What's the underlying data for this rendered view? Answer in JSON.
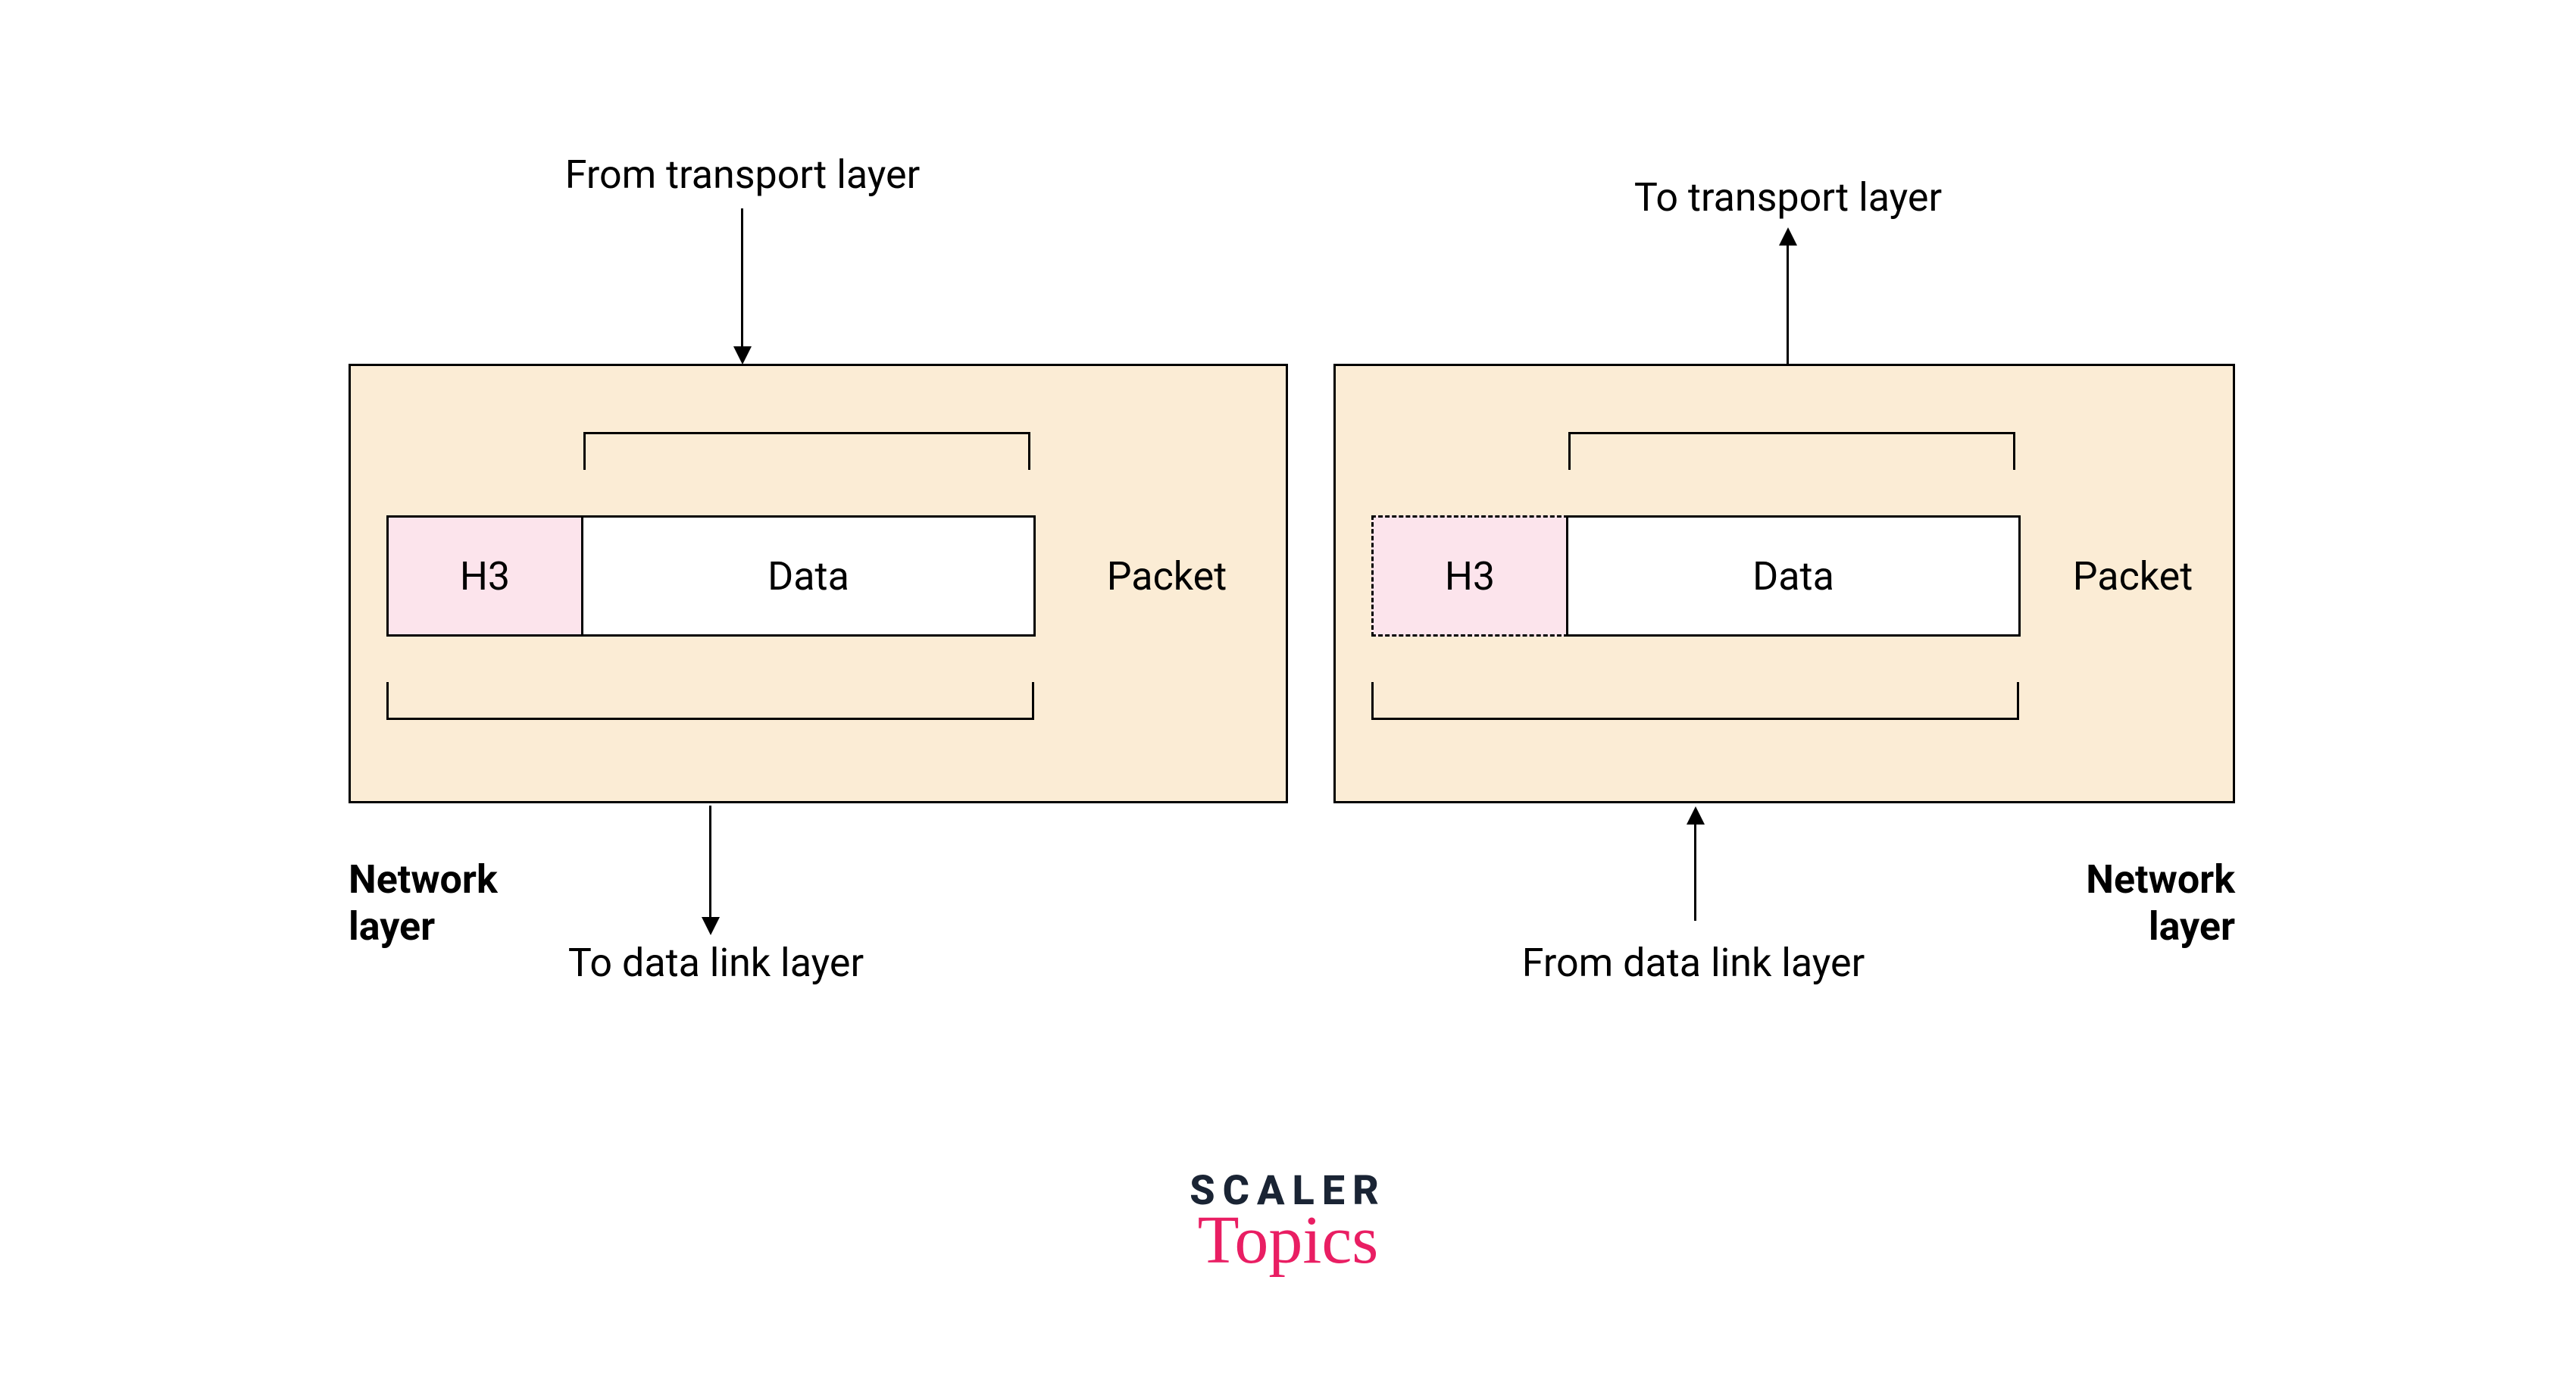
{
  "left": {
    "topLabel": "From transport layer",
    "header": "H3",
    "data": "Data",
    "packet": "Packet",
    "bottomLabel": "To data link layer",
    "layerLabel": "Network\nlayer"
  },
  "right": {
    "topLabel": "To transport layer",
    "header": "H3",
    "data": "Data",
    "packet": "Packet",
    "bottomLabel": "From data link layer",
    "layerLabel": "Network\nlayer"
  },
  "logo": {
    "line1": "SCALER",
    "line2": "Topics"
  }
}
